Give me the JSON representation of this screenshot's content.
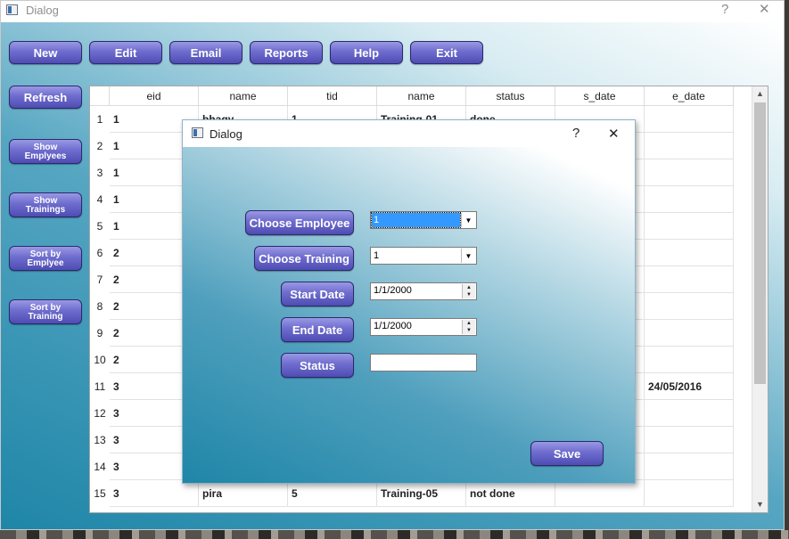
{
  "main_window": {
    "title": "Dialog",
    "help_glyph": "?",
    "close_glyph": "✕"
  },
  "toolbar": [
    "New",
    "Edit",
    "Email",
    "Reports",
    "Help",
    "Exit"
  ],
  "sidebar": {
    "refresh": "Refresh",
    "show_employees": [
      "Show",
      "Emplyees"
    ],
    "show_trainings": [
      "Show",
      "Trainings"
    ],
    "sort_by_employee": [
      "Sort by",
      "Emplyee"
    ],
    "sort_by_training": [
      "Sort by",
      "Training"
    ]
  },
  "table": {
    "headers": [
      "eid",
      "name",
      "tid",
      "name",
      "status",
      "s_date",
      "e_date"
    ],
    "rows": [
      {
        "num": "1",
        "cells": [
          "1",
          "bhagy",
          "1",
          "Training-01",
          "done",
          "",
          ""
        ]
      },
      {
        "num": "2",
        "cells": [
          "1",
          "",
          "",
          "",
          "",
          "",
          ""
        ]
      },
      {
        "num": "3",
        "cells": [
          "1",
          "",
          "",
          "",
          "",
          "",
          ""
        ]
      },
      {
        "num": "4",
        "cells": [
          "1",
          "",
          "",
          "",
          "",
          "",
          ""
        ]
      },
      {
        "num": "5",
        "cells": [
          "1",
          "",
          "",
          "",
          "",
          "",
          ""
        ]
      },
      {
        "num": "6",
        "cells": [
          "2",
          "",
          "",
          "",
          "",
          "",
          ""
        ]
      },
      {
        "num": "7",
        "cells": [
          "2",
          "",
          "",
          "",
          "",
          "",
          ""
        ]
      },
      {
        "num": "8",
        "cells": [
          "2",
          "",
          "",
          "",
          "",
          "",
          ""
        ]
      },
      {
        "num": "9",
        "cells": [
          "2",
          "",
          "",
          "",
          "",
          "",
          ""
        ]
      },
      {
        "num": "10",
        "cells": [
          "2",
          "",
          "",
          "",
          "",
          "",
          ""
        ]
      },
      {
        "num": "11",
        "cells": [
          "3",
          "",
          "",
          "",
          "",
          "",
          "24/05/2016"
        ]
      },
      {
        "num": "12",
        "cells": [
          "3",
          "",
          "",
          "",
          "",
          "",
          ""
        ]
      },
      {
        "num": "13",
        "cells": [
          "3",
          "",
          "",
          "",
          "",
          "",
          ""
        ]
      },
      {
        "num": "14",
        "cells": [
          "3",
          "",
          "",
          "",
          "",
          "",
          ""
        ]
      },
      {
        "num": "15",
        "cells": [
          "3",
          "pira",
          "5",
          "Training-05",
          "not done",
          "",
          ""
        ]
      }
    ]
  },
  "dialog": {
    "title": "Dialog",
    "help_glyph": "?",
    "close_glyph": "✕",
    "choose_employee_label": "Choose Employee",
    "employee_value": "1",
    "choose_training_label": "Choose Training",
    "training_value": "1",
    "start_date_label": "Start Date",
    "start_date_value": "1/1/2000",
    "end_date_label": "End Date",
    "end_date_value": "1/1/2000",
    "status_label": "Status",
    "status_value": "",
    "save_label": "Save"
  }
}
